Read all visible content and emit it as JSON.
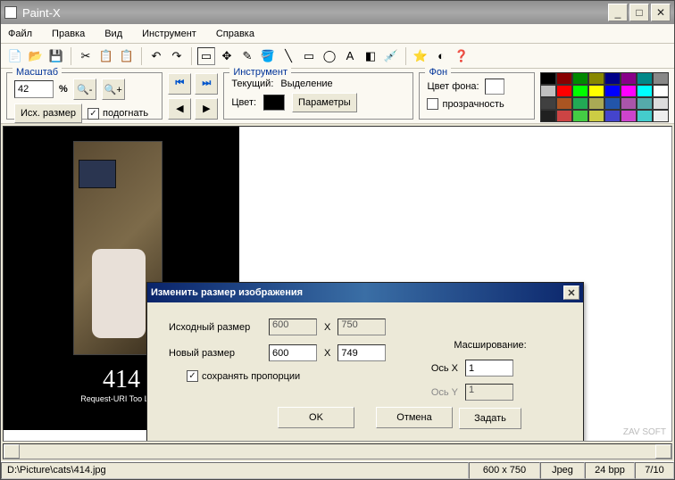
{
  "title": "Paint-X",
  "menu": [
    "Файл",
    "Правка",
    "Вид",
    "Инструмент",
    "Справка"
  ],
  "zoom": {
    "legend": "Масштаб",
    "value": "42",
    "pct": "%",
    "reset": "Исх. размер",
    "fit": "подогнать",
    "fit_checked": "✓"
  },
  "tool": {
    "legend": "Инструмент",
    "current_lbl": "Текущий:",
    "current": "Выделение",
    "color_lbl": "Цвет:",
    "params": "Параметры"
  },
  "bg": {
    "legend": "Фон",
    "color_lbl": "Цвет фона:",
    "trans": "прозрачность"
  },
  "palette": [
    "#000",
    "#800",
    "#080",
    "#880",
    "#008",
    "#808",
    "#088",
    "#888",
    "#c0c0c0",
    "#f00",
    "#0f0",
    "#ff0",
    "#00f",
    "#f0f",
    "#0ff",
    "#fff",
    "#404040",
    "#a52",
    "#2a5",
    "#aa5",
    "#25a",
    "#a5a",
    "#5aa",
    "#ddd",
    "#202020",
    "#c44",
    "#4c4",
    "#cc4",
    "#44c",
    "#c4c",
    "#4cc",
    "#eee"
  ],
  "caption": {
    "big": "414",
    "small": "Request-URI Too Long"
  },
  "status": {
    "path": "D:\\Picture\\cats\\414.jpg",
    "dim": "600 x 750",
    "fmt": "Jpeg",
    "bpp": "24 bpp",
    "page": "7/10"
  },
  "dialog": {
    "title": "Изменить размер изображения",
    "src_lbl": "Исходный размер",
    "src_w": "600",
    "src_h": "750",
    "x": "X",
    "new_lbl": "Новый размер",
    "new_w": "600",
    "new_h": "749",
    "keep": "сохранять пропорции",
    "keep_chk": "✓",
    "scale_lbl": "Масширование:",
    "axis_x": "Ось X",
    "axis_y": "Ось Y",
    "sx": "1",
    "sy": "1",
    "set": "Задать",
    "ok": "OK",
    "cancel": "Отмена"
  },
  "watermark": "ZAV SOFT"
}
